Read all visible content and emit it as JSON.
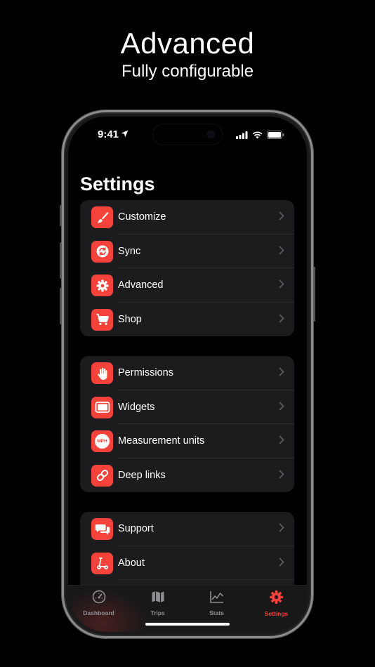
{
  "hero": {
    "title": "Advanced",
    "subtitle": "Fully configurable"
  },
  "status_bar": {
    "time": "9:41"
  },
  "page": {
    "title": "Settings"
  },
  "groups": [
    {
      "items": [
        {
          "label": "Customize",
          "icon": "paintbrush-icon"
        },
        {
          "label": "Sync",
          "icon": "sync-icon"
        },
        {
          "label": "Advanced",
          "icon": "gear-icon"
        },
        {
          "label": "Shop",
          "icon": "cart-icon"
        }
      ]
    },
    {
      "items": [
        {
          "label": "Permissions",
          "icon": "hand-icon"
        },
        {
          "label": "Widgets",
          "icon": "widget-icon"
        },
        {
          "label": "Measurement units",
          "icon": "mph-icon",
          "icon_text": "MPH"
        },
        {
          "label": "Deep links",
          "icon": "link-icon"
        }
      ]
    },
    {
      "items": [
        {
          "label": "Support",
          "icon": "chat-bubbles-icon"
        },
        {
          "label": "About",
          "icon": "scooter-icon"
        }
      ]
    }
  ],
  "tabs": [
    {
      "label": "Dashboard",
      "icon": "speedometer-icon"
    },
    {
      "label": "Trips",
      "icon": "map-icon"
    },
    {
      "label": "Stats",
      "icon": "chart-icon"
    },
    {
      "label": "Settings",
      "icon": "gear-icon",
      "active": true
    }
  ],
  "colors": {
    "accent": "#f5423a",
    "background": "#000000",
    "card": "#1c1c1e",
    "tab_inactive": "#8e8e93"
  }
}
